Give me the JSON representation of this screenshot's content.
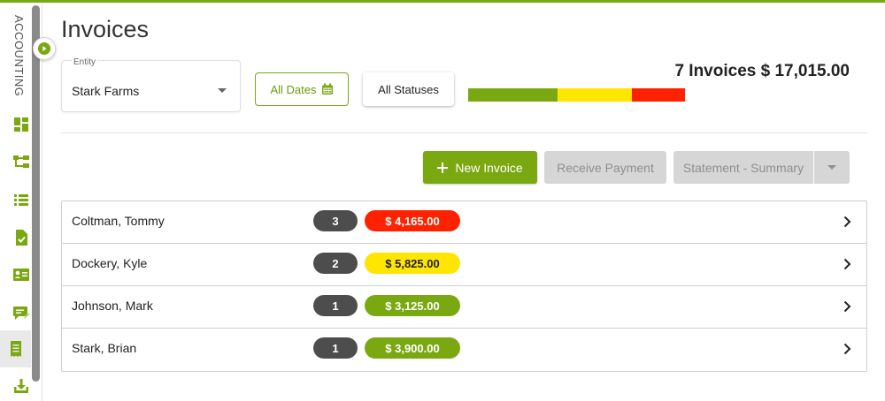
{
  "sidebar": {
    "label": "ACCOUNTING",
    "icons": [
      "dashboard-icon",
      "hierarchy-icon",
      "list-icon",
      "document-check-icon",
      "contact-card-icon",
      "message-edit-icon",
      "receipt-icon",
      "download-icon"
    ],
    "active_icon": "receipt-icon",
    "accent": "#7aa810"
  },
  "page": {
    "title": "Invoices"
  },
  "filters": {
    "entity_caption": "Entity",
    "entity_value": "Stark Farms",
    "dates_label": "All Dates",
    "statuses_label": "All Statuses"
  },
  "summary": {
    "text": "7 Invoices $ 17,015.00",
    "bar": [
      {
        "status": "green",
        "color": "#7aa810",
        "value": 7025.0
      },
      {
        "status": "yellow",
        "color": "#ffe600",
        "value": 5825.0
      },
      {
        "status": "red",
        "color": "#ff2200",
        "value": 4165.0
      }
    ]
  },
  "actions": {
    "new_invoice": "New Invoice",
    "receive_payment": "Receive Payment",
    "statement": "Statement - Summary"
  },
  "invoices": [
    {
      "name": "Coltman, Tommy",
      "count": "3",
      "amount": "$ 4,165.00",
      "status_color": "#ff2200",
      "text_color": "#ffffff"
    },
    {
      "name": "Dockery, Kyle",
      "count": "2",
      "amount": "$ 5,825.00",
      "status_color": "#ffe600",
      "text_color": "#222222"
    },
    {
      "name": "Johnson, Mark",
      "count": "1",
      "amount": "$ 3,125.00",
      "status_color": "#7aa810",
      "text_color": "#ffffff"
    },
    {
      "name": "Stark, Brian",
      "count": "1",
      "amount": "$ 3,900.00",
      "status_color": "#7aa810",
      "text_color": "#ffffff"
    }
  ]
}
